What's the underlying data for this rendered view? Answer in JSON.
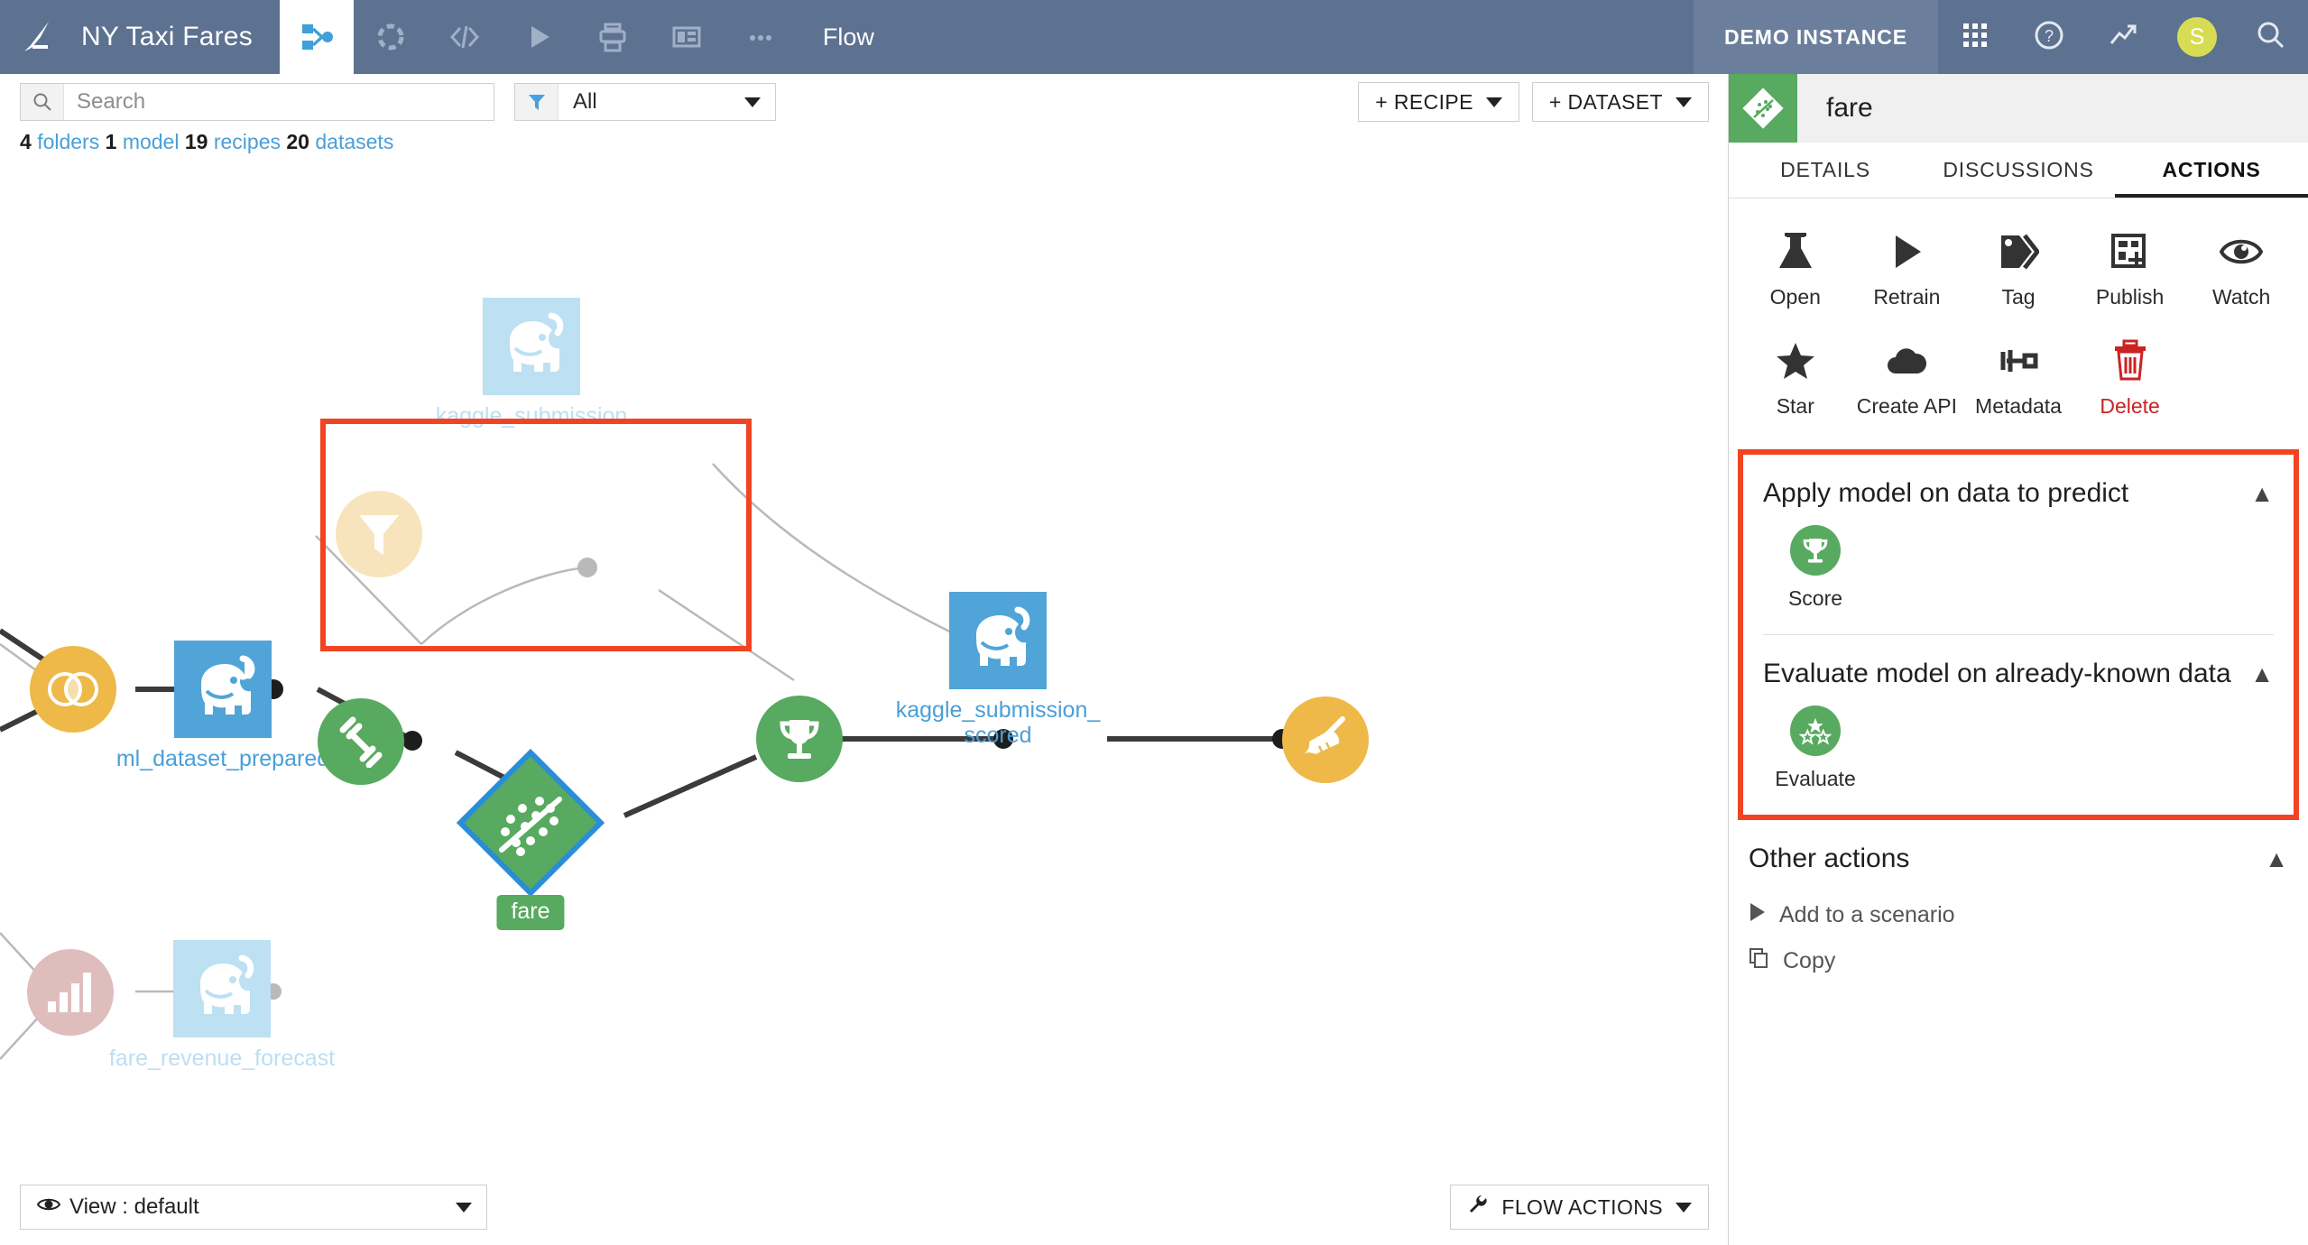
{
  "topnav": {
    "logo_icon": "dataiku-bird-logo",
    "project_name": "NY Taxi Fares",
    "tabs": [
      {
        "icon": "flow-icon",
        "name": "flow",
        "active": true
      },
      {
        "icon": "lab-dashed-circle-icon",
        "name": "lab",
        "active": false
      },
      {
        "icon": "code-icon",
        "name": "code",
        "active": false
      },
      {
        "icon": "play-icon",
        "name": "jobs",
        "active": false
      },
      {
        "icon": "printer-icon",
        "name": "notebooks",
        "active": false
      },
      {
        "icon": "dashboard-icon",
        "name": "dashboards",
        "active": false
      },
      {
        "icon": "more-dots-icon",
        "name": "more",
        "active": false
      }
    ],
    "section_label": "Flow",
    "instance_label": "DEMO INSTANCE",
    "right_icons": [
      {
        "icon": "apps-grid-icon",
        "name": "apps"
      },
      {
        "icon": "help-question-icon",
        "name": "help"
      },
      {
        "icon": "trend-arrow-icon",
        "name": "activity"
      },
      {
        "icon": "avatar-icon",
        "name": "user",
        "initial": "S",
        "color": "#d7dd52"
      },
      {
        "icon": "search-icon",
        "name": "global-search"
      }
    ]
  },
  "toolbar": {
    "search_placeholder": "Search",
    "search_value": "",
    "search_icon": "search-icon",
    "filter_icon": "funnel-filter-icon",
    "filter_value": "All",
    "recipe_button": "+ RECIPE",
    "dataset_button": "+ DATASET"
  },
  "stats": {
    "folders_count": "4",
    "folders_label": "folders",
    "model_count": "1",
    "model_label": "model",
    "recipes_count": "19",
    "recipes_label": "recipes",
    "datasets_count": "20",
    "datasets_label": "datasets"
  },
  "flow": {
    "nodes": {
      "join_recipe": {
        "label": "",
        "icon": "join-venn-icon",
        "type": "recipe",
        "color": "#eeb949"
      },
      "ml_dataset_prepared": {
        "label": "ml_dataset_prepared",
        "icon": "hadoop-elephant-icon",
        "type": "dataset",
        "color": "#50a4d8"
      },
      "filter_recipe": {
        "label": "",
        "icon": "funnel-filter-icon",
        "type": "recipe",
        "color": "#f8e4bc",
        "dimmed": true
      },
      "kaggle_submission": {
        "label": "kaggle_submission",
        "icon": "hadoop-elephant-icon",
        "type": "dataset",
        "color": "#bde0f2",
        "dimmed": true
      },
      "chart_recipe": {
        "label": "",
        "icon": "bar-chart-icon",
        "type": "recipe",
        "color": "#e0bdbd",
        "dimmed": true
      },
      "fare_revenue_forecast": {
        "label": "fare_revenue_forecast",
        "icon": "hadoop-elephant-icon",
        "type": "dataset",
        "color": "#bde0f2",
        "dimmed": true
      },
      "train_recipe": {
        "label": "",
        "icon": "dumbbell-train-icon",
        "type": "recipe",
        "color": "#57aa5f"
      },
      "fare_model": {
        "label": "fare",
        "icon": "scatter-regression-icon",
        "type": "model",
        "color": "#57aa5f",
        "selected": true
      },
      "score_recipe": {
        "label": "",
        "icon": "trophy-score-icon",
        "type": "recipe",
        "color": "#57aa5f"
      },
      "kaggle_submission_scored": {
        "label": "kaggle_submission_\nscored",
        "label_line1": "kaggle_submission_",
        "label_line2": "scored",
        "icon": "hadoop-elephant-icon",
        "type": "dataset",
        "color": "#50a4d8"
      },
      "prepare_recipe": {
        "label": "",
        "icon": "broom-prepare-icon",
        "type": "recipe",
        "color": "#eeb949"
      }
    },
    "highlight_color": "#f04423"
  },
  "bottombar": {
    "view_icon": "eye-icon",
    "view_label": "View : default",
    "flow_actions_icon": "wrench-icon",
    "flow_actions_label": "FLOW ACTIONS"
  },
  "rightpanel": {
    "object_icon": "model-diamond-icon",
    "object_name": "fare",
    "tabs": [
      {
        "label": "DETAILS",
        "active": false
      },
      {
        "label": "DISCUSSIONS",
        "active": false
      },
      {
        "label": "ACTIONS",
        "active": true
      }
    ],
    "quick_actions": [
      {
        "label": "Open",
        "icon": "flask-icon",
        "danger": false
      },
      {
        "label": "Retrain",
        "icon": "play-icon",
        "danger": false
      },
      {
        "label": "Tag",
        "icon": "tag-icon",
        "danger": false
      },
      {
        "label": "Publish",
        "icon": "publish-icon",
        "danger": false
      },
      {
        "label": "Watch",
        "icon": "eye-icon",
        "danger": false
      },
      {
        "label": "Star",
        "icon": "star-icon",
        "danger": false
      },
      {
        "label": "Create API",
        "icon": "cloud-icon",
        "danger": false
      },
      {
        "label": "Metadata",
        "icon": "metadata-icon",
        "danger": false
      },
      {
        "label": "Delete",
        "icon": "trash-icon",
        "danger": true
      }
    ],
    "sections": [
      {
        "title": "Apply model on data to predict",
        "chevron": "chevron-up-icon",
        "actions": [
          {
            "label": "Score",
            "icon": "trophy-icon"
          }
        ]
      },
      {
        "title": "Evaluate model on already-known data",
        "chevron": "chevron-up-icon",
        "actions": [
          {
            "label": "Evaluate",
            "icon": "three-stars-icon"
          }
        ]
      }
    ],
    "other_actions": {
      "title": "Other actions",
      "chevron": "chevron-up-icon",
      "items": [
        {
          "label": "Add to a scenario",
          "icon": "play-triangle-icon"
        },
        {
          "label": "Copy",
          "icon": "copy-icon"
        }
      ]
    },
    "highlight_color": "#f04423"
  }
}
